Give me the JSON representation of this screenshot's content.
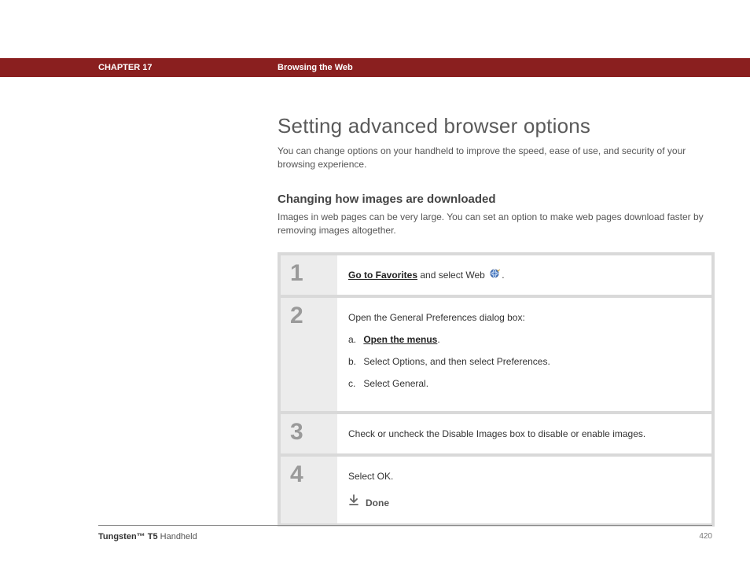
{
  "header": {
    "chapter": "CHAPTER 17",
    "title": "Browsing the Web"
  },
  "main": {
    "h1": "Setting advanced browser options",
    "intro": "You can change options on your handheld to improve the speed, ease of use, and security of your browsing experience.",
    "h2": "Changing how images are downloaded",
    "subintro": "Images in web pages can be very large. You can set an option to make web pages download faster by removing images altogether."
  },
  "steps": {
    "s1": {
      "num": "1",
      "link": "Go to Favorites",
      "rest": " and select Web ",
      "period": "."
    },
    "s2": {
      "num": "2",
      "lead": "Open the General Preferences dialog box:",
      "a_label": "a.",
      "a_link": "Open the menus",
      "a_period": ".",
      "b_label": "b.",
      "b_text": "Select Options, and then select Preferences.",
      "c_label": "c.",
      "c_text": "Select General."
    },
    "s3": {
      "num": "3",
      "text": "Check or uncheck the Disable Images box to disable or enable images."
    },
    "s4": {
      "num": "4",
      "text": "Select OK.",
      "done": "Done"
    }
  },
  "footer": {
    "product_bold": "Tungsten™ T5",
    "product_rest": " Handheld",
    "page": "420"
  }
}
